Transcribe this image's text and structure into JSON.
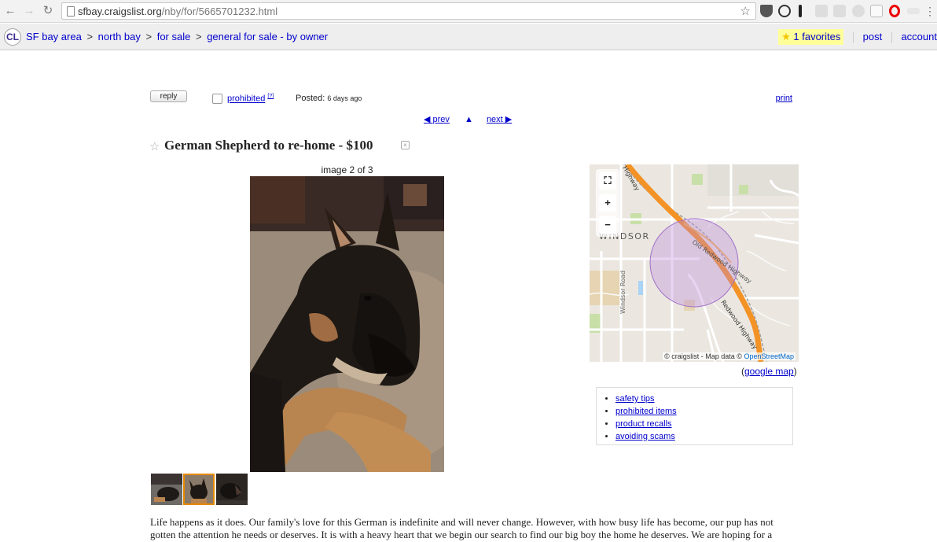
{
  "browser": {
    "url_host": "sfbay.craigslist.org",
    "url_path": "/nby/for/5665701232.html"
  },
  "header": {
    "logo": "CL",
    "breadcrumbs": [
      "SF bay area",
      "north bay",
      "for sale",
      "general for sale - by owner"
    ],
    "breadcrumb_separator": ">",
    "favorites_label": "1 favorites",
    "post_label": "post",
    "account_label": "account"
  },
  "posting": {
    "reply_label": "reply",
    "prohibited_label": "prohibited",
    "prohibited_help": "[?]",
    "posted_label": "Posted:",
    "posted_ago": "6 days ago",
    "print_label": "print",
    "prev_label": "prev",
    "next_label": "next",
    "title": "German Shepherd to re-home - $100",
    "image_caption": "image 2 of 3",
    "thumbnails_selected": 2,
    "body": "Life happens as it does. Our family's love for this German is indefinite and will never change. However, with how busy life has become, our pup has not gotten the attention he needs or deserves. It is with a heavy heart that we begin our search to find our big boy the home he deserves. We are hoping for a"
  },
  "map": {
    "town_label": "WINDSOR",
    "road_labels": [
      "Highway",
      "Old Redwood Highway",
      "Redwood Highway",
      "Windsor Road"
    ],
    "attribution_prefix": "© craigslist - Map data ©",
    "attribution_link": "OpenStreetMap",
    "google_map_label": "google map"
  },
  "safety_links": [
    "safety tips",
    "prohibited items",
    "product recalls",
    "avoiding scams"
  ]
}
